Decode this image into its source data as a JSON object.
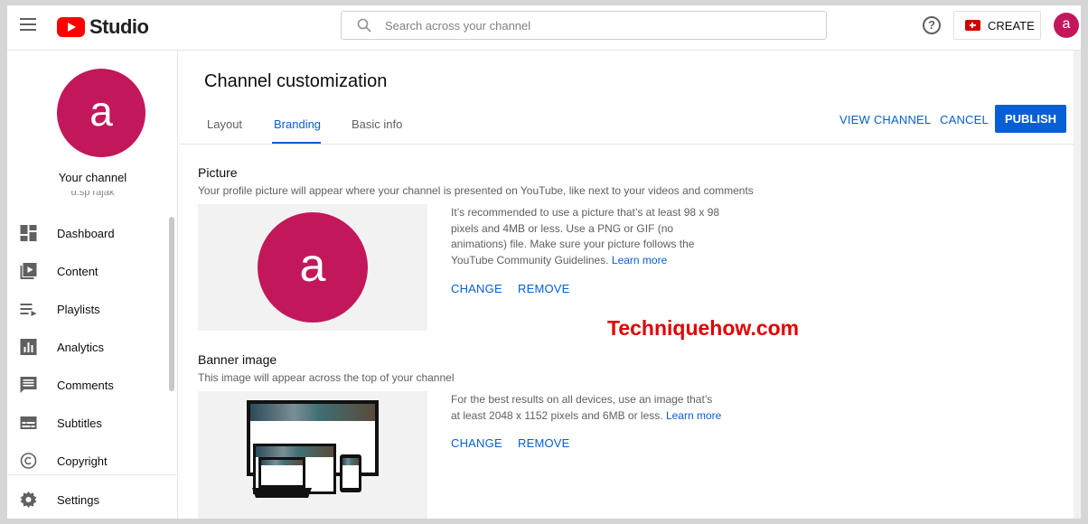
{
  "app": {
    "logo_text": "Studio",
    "search_placeholder": "Search across your channel",
    "create_label": "CREATE",
    "avatar_letter": "a"
  },
  "sidebar": {
    "avatar_letter": "a",
    "your_channel": "Your channel",
    "handle": "d.sp rajak",
    "items": [
      {
        "label": "Dashboard",
        "icon": "dashboard-icon"
      },
      {
        "label": "Content",
        "icon": "content-icon"
      },
      {
        "label": "Playlists",
        "icon": "playlists-icon"
      },
      {
        "label": "Analytics",
        "icon": "analytics-icon"
      },
      {
        "label": "Comments",
        "icon": "comments-icon"
      },
      {
        "label": "Subtitles",
        "icon": "subtitles-icon"
      },
      {
        "label": "Copyright",
        "icon": "copyright-icon"
      },
      {
        "label": "Settings",
        "icon": "settings-icon"
      }
    ]
  },
  "main": {
    "title": "Channel customization",
    "tabs": [
      {
        "label": "Layout",
        "active": false
      },
      {
        "label": "Branding",
        "active": true
      },
      {
        "label": "Basic info",
        "active": false
      }
    ],
    "view_channel": "VIEW CHANNEL",
    "cancel": "CANCEL",
    "publish": "PUBLISH",
    "picture": {
      "title": "Picture",
      "description": "Your profile picture will appear where your channel is presented on YouTube, like next to your videos and comments",
      "avatar_letter": "a",
      "info": "It’s recommended to use a picture that’s at least 98 x 98 pixels and 4MB or less. Use a PNG or GIF (no animations) file. Make sure your picture follows the YouTube Community Guidelines.",
      "link": "Learn more",
      "change": "CHANGE",
      "remove": "REMOVE"
    },
    "banner": {
      "title": "Banner image",
      "description": "This image will appear across the top of your channel",
      "info": "For the best results on all devices, use an image that’s at least 2048 x 1152 pixels and 6MB or less.",
      "link": "Learn more",
      "change": "CHANGE",
      "remove": "REMOVE"
    },
    "watermark": "Techniquehow.com"
  },
  "colors": {
    "accent": "#065fd4",
    "youtube_red": "#ff0000",
    "avatar": "#c2185b",
    "watermark": "#e00000"
  }
}
